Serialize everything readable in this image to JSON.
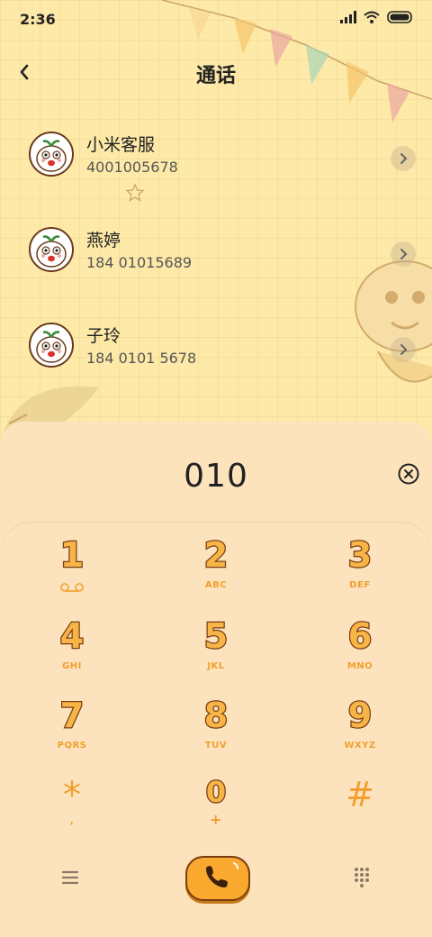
{
  "status_bar": {
    "time": "2:36",
    "icons": [
      "signal-icon",
      "wifi-icon",
      "battery-icon"
    ]
  },
  "header": {
    "title": "通话",
    "back_icon": "back-arrow-icon"
  },
  "contacts": [
    {
      "name": "小米客服",
      "number": "4001005678"
    },
    {
      "name": "燕婷",
      "number": "184 01015689"
    },
    {
      "name": "子玲",
      "number": "184 0101 5678"
    }
  ],
  "dialer": {
    "entered_number": "010",
    "clear_icon": "clear-icon",
    "keys": [
      {
        "digit": "1",
        "letters": "voicemail-icon"
      },
      {
        "digit": "2",
        "letters": "ABC"
      },
      {
        "digit": "3",
        "letters": "DEF"
      },
      {
        "digit": "4",
        "letters": "GHI"
      },
      {
        "digit": "5",
        "letters": "JKL"
      },
      {
        "digit": "6",
        "letters": "MNO"
      },
      {
        "digit": "7",
        "letters": "PQRS"
      },
      {
        "digit": "8",
        "letters": "TUV"
      },
      {
        "digit": "9",
        "letters": "WXYZ"
      },
      {
        "digit": "*",
        "letters": ","
      },
      {
        "digit": "0",
        "letters": "+"
      },
      {
        "digit": "#",
        "letters": ""
      }
    ]
  },
  "bottom_bar": {
    "menu_icon": "menu-icon",
    "call_icon": "phone-icon",
    "keypad_icon": "keypad-icon"
  },
  "colors": {
    "background": "#FDE9A8",
    "panel": "#FDE3BC",
    "key_fill": "#F8B547",
    "key_outline": "#7a3d12",
    "call_button": "#F8A92E"
  }
}
